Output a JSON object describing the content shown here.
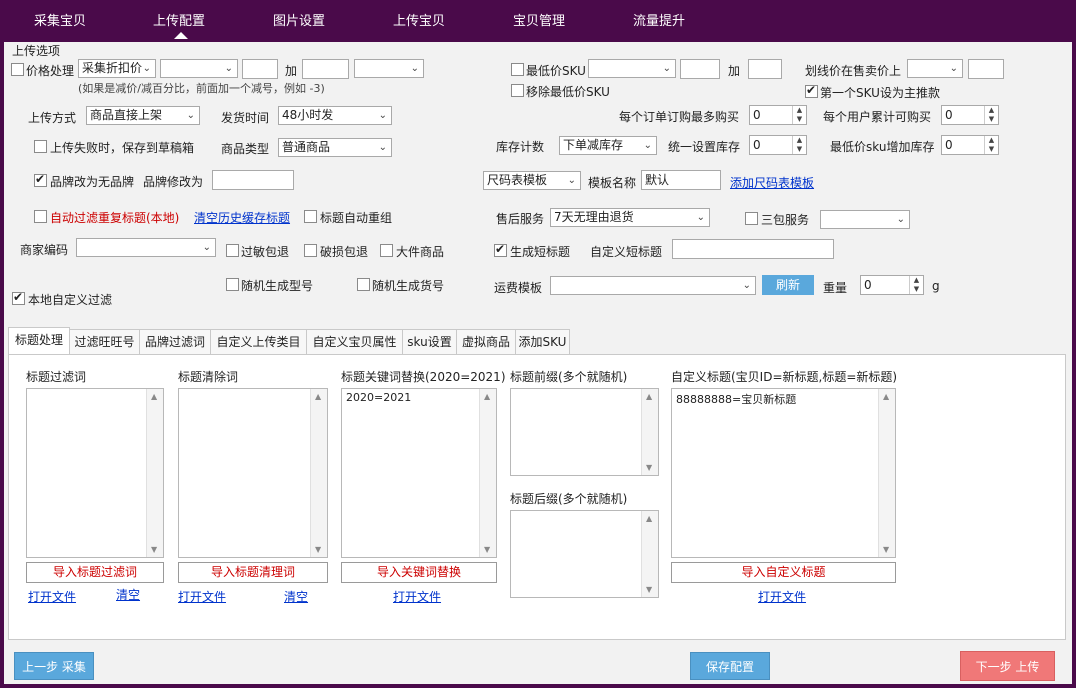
{
  "nav": {
    "items": [
      "采集宝贝",
      "上传配置",
      "图片设置",
      "上传宝贝",
      "宝贝管理",
      "流量提升"
    ],
    "active_index": 1
  },
  "group_title": "上传选项",
  "price": {
    "label": "价格处理",
    "mode": "采集折扣价",
    "select2": "",
    "value1": "",
    "plus_label": "加",
    "value2": "",
    "select3": "",
    "hint": "(如果是减价/减百分比，前面加一个减号，例如 -3)",
    "checked": false
  },
  "lowest_sku": {
    "label": "最低价SKU",
    "checked": false,
    "select": "",
    "value1": "",
    "plus_label": "加",
    "value2": ""
  },
  "remove_lowest_sku": {
    "label": "移除最低价SKU",
    "checked": false
  },
  "crossed_price": {
    "label": "划线价在售卖价上",
    "select": "",
    "value": ""
  },
  "first_sku_main": {
    "label": "第一个SKU设为主推款",
    "checked": true
  },
  "upload_mode": {
    "label": "上传方式",
    "value": "商品直接上架"
  },
  "ship_time": {
    "label": "发货时间",
    "value": "48小时发"
  },
  "max_per_order": {
    "label": "每个订单订购最多购买",
    "value": "0"
  },
  "max_per_user": {
    "label": "每个用户累计可购买",
    "value": "0"
  },
  "save_draft": {
    "label": "上传失败时，保存到草稿箱",
    "checked": false
  },
  "product_type": {
    "label": "商品类型",
    "value": "普通商品"
  },
  "stock_count": {
    "label": "库存计数",
    "value": "下单减库存"
  },
  "unified_stock": {
    "label": "统一设置库存",
    "value": "0"
  },
  "lowest_sku_stock": {
    "label": "最低价sku增加库存",
    "value": "0"
  },
  "brand_none": {
    "label": "品牌改为无品牌",
    "checked": true
  },
  "brand_change": {
    "label": "品牌修改为",
    "value": ""
  },
  "size_template": {
    "select": "尺码表模板",
    "name_label": "模板名称",
    "name_value": "默认",
    "add_link": "添加尺码表模板"
  },
  "auto_filter_dup": {
    "label": "自动过滤重复标题(本地)",
    "checked": false
  },
  "clear_history": "清空历史缓存标题",
  "auto_regroup": {
    "label": "标题自动重组",
    "checked": false
  },
  "after_sale": {
    "label": "售后服务",
    "value": "7天无理由退货"
  },
  "three_guarantee": {
    "label": "三包服务",
    "checked": false,
    "value": ""
  },
  "merchant_code": {
    "label": "商家编码",
    "value": ""
  },
  "allergy": {
    "label": "过敏包退",
    "checked": false
  },
  "damage": {
    "label": "破损包退",
    "checked": false
  },
  "large_item": {
    "label": "大件商品",
    "checked": false
  },
  "short_title": {
    "label": "生成短标题",
    "checked": true
  },
  "custom_short_title": {
    "label": "自定义短标题",
    "value": ""
  },
  "local_filter": {
    "label": "本地自定义过滤",
    "checked": true
  },
  "random_model": {
    "label": "随机生成型号",
    "checked": false
  },
  "random_item_no": {
    "label": "随机生成货号",
    "checked": false
  },
  "shipping_template": {
    "label": "运费模板",
    "value": "",
    "refresh": "刷新"
  },
  "weight": {
    "label": "重量",
    "value": "0",
    "unit": "g"
  },
  "tabs": [
    "标题处理",
    "过滤旺旺号",
    "品牌过滤词",
    "自定义上传类目",
    "自定义宝贝属性",
    "sku设置",
    "虚拟商品",
    "添加SKU"
  ],
  "active_tab": 0,
  "panes": {
    "filter_words": {
      "label": "标题过滤词",
      "content": "",
      "import": "导入标题过滤词",
      "open": "打开文件",
      "clear": "清空"
    },
    "clear_words": {
      "label": "标题清除词",
      "content": "",
      "import": "导入标题清理词",
      "open": "打开文件",
      "clear": "清空"
    },
    "keyword_replace": {
      "label": "标题关键词替换(2020=2021)",
      "content": "2020=2021",
      "import": "导入关键词替换",
      "open": "打开文件"
    },
    "prefix": {
      "label": "标题前缀(多个就随机)",
      "content": ""
    },
    "suffix": {
      "label": "标题后缀(多个就随机)",
      "content": ""
    },
    "custom_title": {
      "label": "自定义标题(宝贝ID=新标题,标题=新标题)",
      "content": "88888888=宝贝新标题",
      "import": "导入自定义标题",
      "open": "打开文件"
    }
  },
  "footer": {
    "prev": "上一步 采集",
    "save": "保存配置",
    "next": "下一步 上传"
  },
  "colors": {
    "nav_bg": "#4a0a4a",
    "primary": "#5aa8dc",
    "danger": "#f07878",
    "link": "#0033cc",
    "red_text": "#cc0000"
  }
}
